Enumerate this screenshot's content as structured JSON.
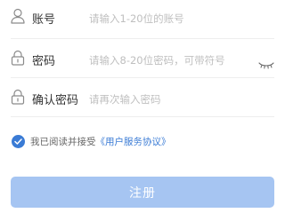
{
  "form": {
    "account": {
      "label": "账号",
      "placeholder": "请输入1-20位的账号",
      "value": "",
      "icon": "user-icon"
    },
    "password": {
      "label": "密码",
      "placeholder": "请输入8-20位密码，可带符号",
      "value": "",
      "icon": "lock-icon",
      "toggle_icon": "eye-closed-icon"
    },
    "confirm_password": {
      "label": "确认密码",
      "placeholder": "请再次输入密码",
      "value": "",
      "icon": "lock-icon"
    }
  },
  "agreement": {
    "checked": true,
    "text": "我已阅读并接受",
    "link_text": "《用户服务协议》"
  },
  "submit": {
    "label": "注册"
  },
  "colors": {
    "accent": "#3a7bd5",
    "button_bg": "#a6c5f2",
    "placeholder": "#bfbfbf",
    "divider": "#eeeeee"
  }
}
